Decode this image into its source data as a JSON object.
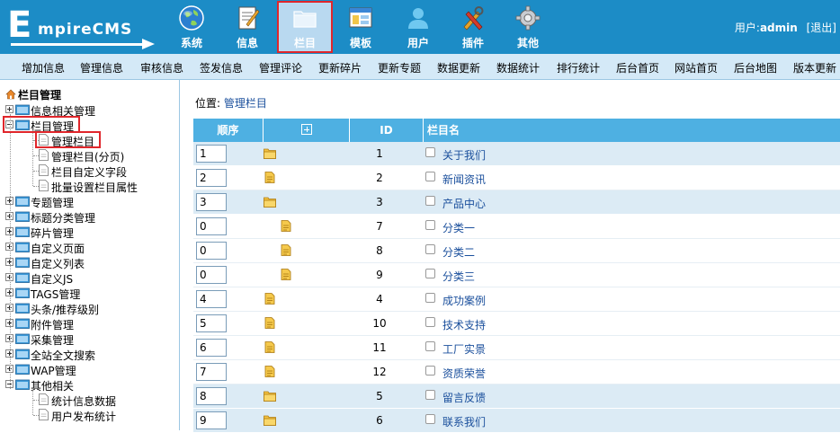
{
  "brand": {
    "e": "E",
    "rest": "mpireCMS"
  },
  "topnav": [
    {
      "label": "系统",
      "icon": "globe-icon"
    },
    {
      "label": "信息",
      "icon": "document-icon"
    },
    {
      "label": "栏目",
      "icon": "folder-icon",
      "active": true
    },
    {
      "label": "模板",
      "icon": "window-icon"
    },
    {
      "label": "用户",
      "icon": "user-icon"
    },
    {
      "label": "插件",
      "icon": "tools-icon"
    },
    {
      "label": "其他",
      "icon": "gear-icon"
    }
  ],
  "user": {
    "prefix": "用户:",
    "name": "admin",
    "logout": "[退出]"
  },
  "subnav": [
    "增加信息",
    "管理信息",
    "审核信息",
    "签发信息",
    "管理评论",
    "更新碎片",
    "更新专题",
    "数据更新",
    "数据统计",
    "排行统计",
    "后台首页",
    "网站首页",
    "后台地图",
    "版本更新"
  ],
  "sidebar": {
    "title": "栏目管理",
    "items": [
      {
        "label": "信息相关管理",
        "type": "folder",
        "pm": "plus"
      },
      {
        "label": "栏目管理",
        "type": "folder",
        "pm": "minus"
      },
      {
        "label": "管理栏目",
        "type": "leaf"
      },
      {
        "label": "管理栏目(分页)",
        "type": "leaf"
      },
      {
        "label": "栏目自定义字段",
        "type": "leaf"
      },
      {
        "label": "批量设置栏目属性",
        "type": "leaf"
      },
      {
        "label": "专题管理",
        "type": "folder",
        "pm": "plus"
      },
      {
        "label": "标题分类管理",
        "type": "folder",
        "pm": "plus"
      },
      {
        "label": "碎片管理",
        "type": "folder",
        "pm": "plus"
      },
      {
        "label": "自定义页面",
        "type": "folder",
        "pm": "plus"
      },
      {
        "label": "自定义列表",
        "type": "folder",
        "pm": "plus"
      },
      {
        "label": "自定义JS",
        "type": "folder",
        "pm": "plus"
      },
      {
        "label": "TAGS管理",
        "type": "folder",
        "pm": "plus"
      },
      {
        "label": "头条/推荐级别",
        "type": "folder",
        "pm": "plus"
      },
      {
        "label": "附件管理",
        "type": "folder",
        "pm": "plus"
      },
      {
        "label": "采集管理",
        "type": "folder",
        "pm": "plus"
      },
      {
        "label": "全站全文搜索",
        "type": "folder",
        "pm": "plus"
      },
      {
        "label": "WAP管理",
        "type": "folder",
        "pm": "plus"
      },
      {
        "label": "其他相关",
        "type": "folder",
        "pm": "minus"
      },
      {
        "label": "统计信息数据",
        "type": "leaf"
      },
      {
        "label": "用户发布统计",
        "type": "leaf"
      }
    ]
  },
  "breadcrumb": {
    "prefix": "位置:",
    "link": "管理栏目"
  },
  "grid": {
    "headers": {
      "order": "顺序",
      "id": "ID",
      "name": "栏目名"
    },
    "rows": [
      {
        "order": "1",
        "icon": "folder",
        "indent": 0,
        "id": "1",
        "name": "关于我们",
        "bg": "alt"
      },
      {
        "order": "2",
        "icon": "file",
        "indent": 0,
        "id": "2",
        "name": "新闻资讯",
        "bg": "plain"
      },
      {
        "order": "3",
        "icon": "folder",
        "indent": 0,
        "id": "3",
        "name": "产品中心",
        "bg": "alt"
      },
      {
        "order": "0",
        "icon": "file",
        "indent": 1,
        "id": "7",
        "name": "分类一",
        "bg": "plain"
      },
      {
        "order": "0",
        "icon": "file",
        "indent": 1,
        "id": "8",
        "name": "分类二",
        "bg": "plain"
      },
      {
        "order": "0",
        "icon": "file",
        "indent": 1,
        "id": "9",
        "name": "分类三",
        "bg": "plain"
      },
      {
        "order": "4",
        "icon": "file",
        "indent": 0,
        "id": "4",
        "name": "成功案例",
        "bg": "plain"
      },
      {
        "order": "5",
        "icon": "file",
        "indent": 0,
        "id": "10",
        "name": "技术支持",
        "bg": "plain"
      },
      {
        "order": "6",
        "icon": "file",
        "indent": 0,
        "id": "11",
        "name": "工厂实景",
        "bg": "plain"
      },
      {
        "order": "7",
        "icon": "file",
        "indent": 0,
        "id": "12",
        "name": "资质荣誉",
        "bg": "plain"
      },
      {
        "order": "8",
        "icon": "folder",
        "indent": 0,
        "id": "5",
        "name": "留言反馈",
        "bg": "alt"
      },
      {
        "order": "9",
        "icon": "folder",
        "indent": 0,
        "id": "6",
        "name": "联系我们",
        "bg": "alt"
      }
    ]
  }
}
